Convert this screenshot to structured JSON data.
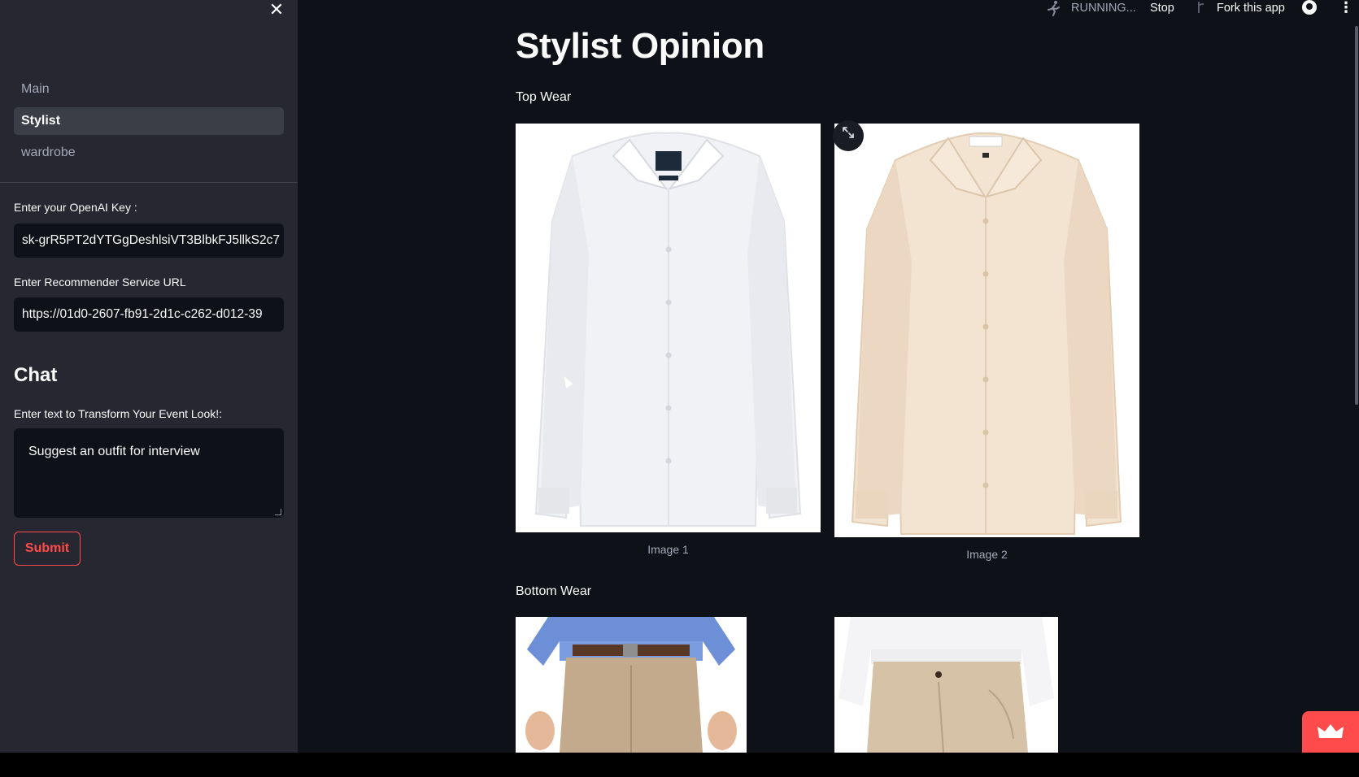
{
  "sidebar": {
    "close_label": "✕",
    "nav": {
      "items": [
        {
          "label": "Main"
        },
        {
          "label": "Stylist"
        },
        {
          "label": "wardrobe"
        }
      ]
    },
    "openai_key": {
      "label": "Enter your OpenAI Key :",
      "value": "sk-grR5PT2dYTGgDeshlsiVT3BlbkFJ5llkS2c7"
    },
    "service_url": {
      "label": "Enter Recommender Service URL",
      "value": "https://01d0-2607-fb91-2d1c-c262-d012-39"
    },
    "chat": {
      "heading": "Chat",
      "label": "Enter text to Transform Your Event Look!:",
      "value": "Suggest an outfit for interview",
      "submit_label": "Submit"
    }
  },
  "toolbar": {
    "status": "RUNNING...",
    "stop_label": "Stop",
    "fork_label": "Fork this app",
    "menu_glyph": "⋮"
  },
  "main": {
    "title": "Stylist Opinion",
    "top_wear": {
      "label": "Top Wear",
      "images": [
        {
          "caption": "Image 1"
        },
        {
          "caption": "Image 2"
        }
      ]
    },
    "bottom_wear": {
      "label": "Bottom Wear"
    }
  },
  "icons": {
    "expand": "expand-icon",
    "running": "running-man-icon",
    "fork": "fork-icon",
    "github": "github-icon",
    "crown": "crown-icon"
  },
  "colors": {
    "background": "#0e1117",
    "sidebar": "#262730",
    "accent": "#ff4b4b",
    "shirt_white": "#f1f2f5",
    "shirt_cream": "#f3e3d1",
    "trouser_khaki": "#c3aa8c",
    "shirt_blue": "#6d8fd8"
  }
}
